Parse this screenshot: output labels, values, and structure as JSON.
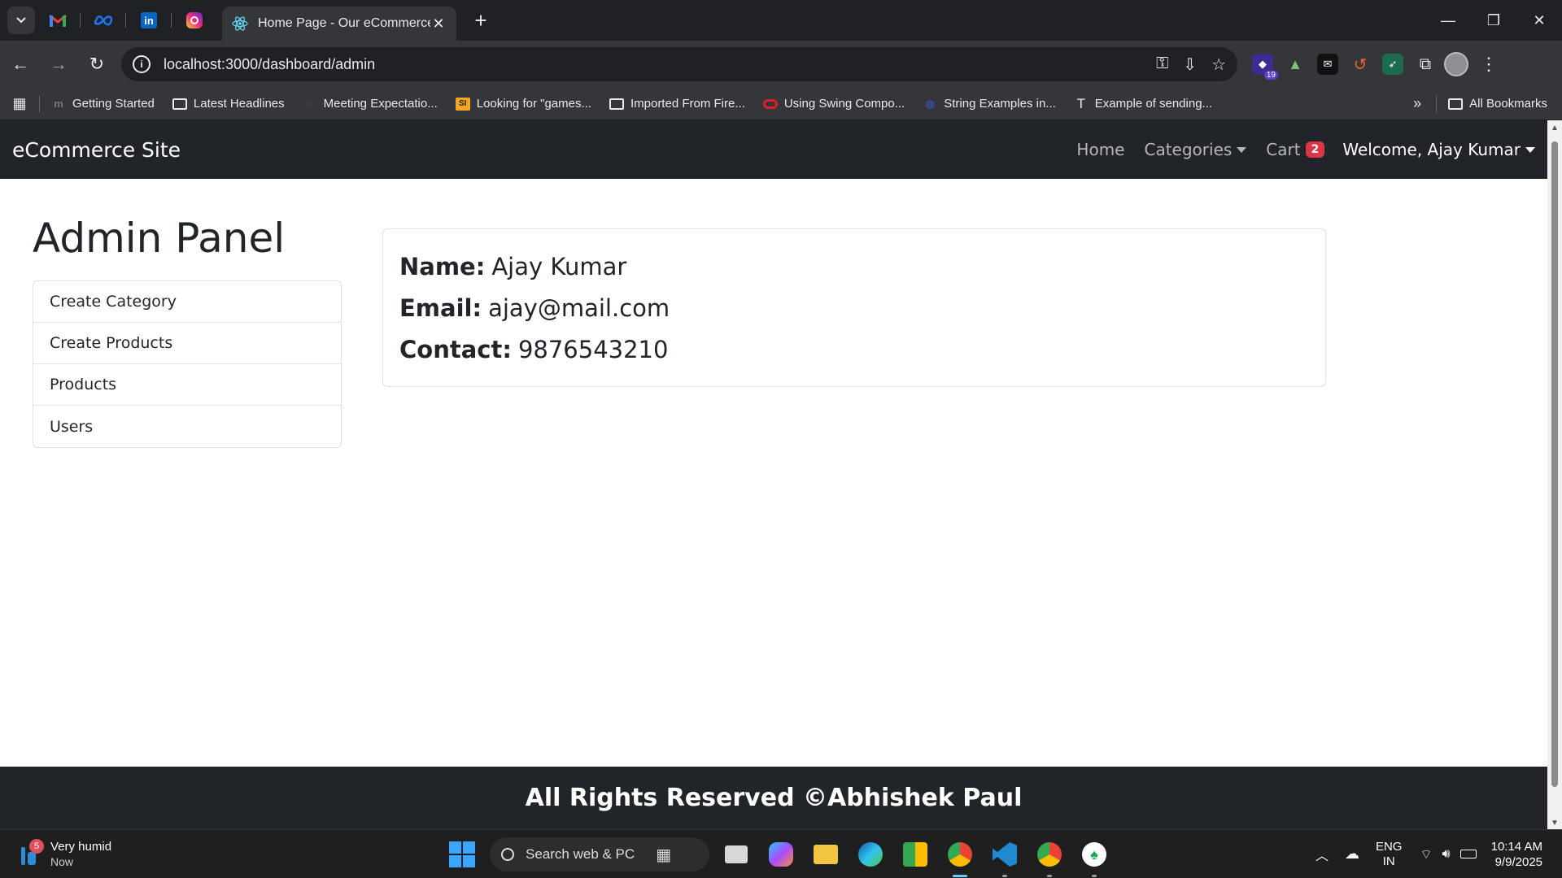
{
  "browser": {
    "tab_title": "Home Page - Our eCommerce Site",
    "url": "localhost:3000/dashboard/admin",
    "extension_badge": "19",
    "bookmarks": [
      {
        "label": "Getting Started",
        "icon": "m-icon"
      },
      {
        "label": "Latest Headlines",
        "icon": "folder-icon"
      },
      {
        "label": "Meeting Expectatio...",
        "icon": "page-icon"
      },
      {
        "label": "Looking for \"games...",
        "icon": "si-icon"
      },
      {
        "label": "Imported From Fire...",
        "icon": "folder-icon"
      },
      {
        "label": "Using Swing Compo...",
        "icon": "oracle-icon"
      },
      {
        "label": "String Examples in...",
        "icon": "globe-icon"
      },
      {
        "label": "Example of sending...",
        "icon": "t-icon"
      }
    ],
    "all_bookmarks": "All Bookmarks"
  },
  "site": {
    "brand": "eCommerce Site",
    "nav": {
      "home": "Home",
      "categories": "Categories",
      "cart": "Cart",
      "cart_count": "2",
      "welcome": "Welcome, Ajay Kumar"
    },
    "admin_title": "Admin Panel",
    "menu": [
      "Create Category",
      "Create Products",
      "Products",
      "Users"
    ],
    "profile": {
      "name_label": "Name:",
      "name": "Ajay Kumar",
      "email_label": "Email:",
      "email": "ajay@mail.com",
      "contact_label": "Contact:",
      "contact": "9876543210"
    },
    "footer": "All Rights Reserved ©Abhishek Paul"
  },
  "taskbar": {
    "weather_badge": "5",
    "weather_line1": "Very humid",
    "weather_line2": "Now",
    "search": "Search web & PC",
    "lang_line1": "ENG",
    "lang_line2": "IN",
    "time": "10:14 AM",
    "date": "9/9/2025"
  },
  "colors": {
    "navbar_bg": "#212529",
    "badge_red": "#dc3545",
    "chrome_dark": "#202124",
    "chrome_toolbar": "#35363a"
  }
}
